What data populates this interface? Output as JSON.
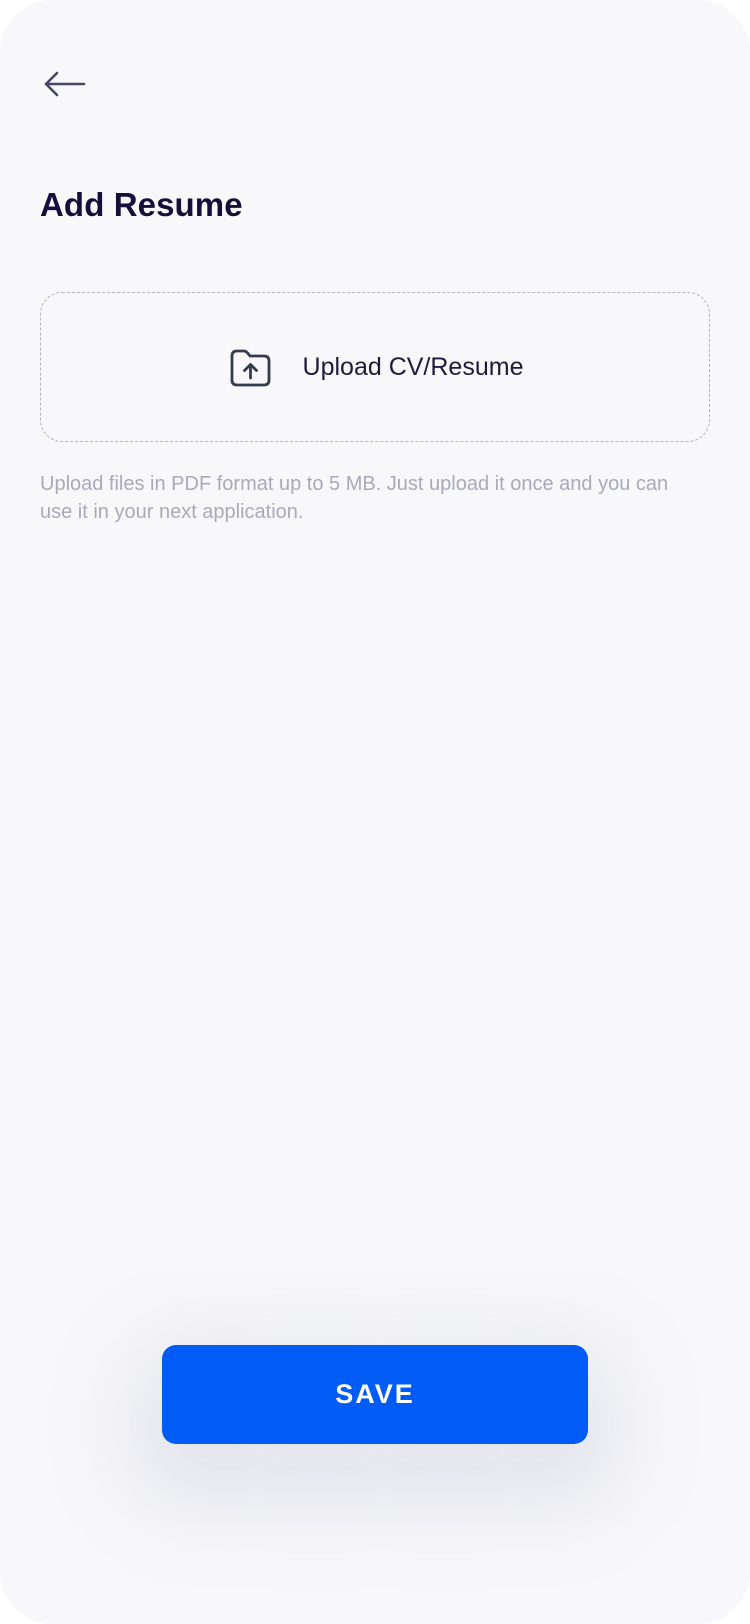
{
  "header": {
    "back_icon": "arrow-left-icon",
    "title": "Add Resume"
  },
  "upload": {
    "icon": "folder-upload-icon",
    "label": "Upload CV/Resume",
    "hint": "Upload files in PDF format up to 5 MB. Just upload it once and you can use it in your next application."
  },
  "actions": {
    "save_label": "SAVE"
  },
  "colors": {
    "background": "#f8f8fa",
    "title": "#160f3a",
    "hint": "#a9a9bb",
    "primary": "#005cf5",
    "border": "#b4b4c0"
  }
}
